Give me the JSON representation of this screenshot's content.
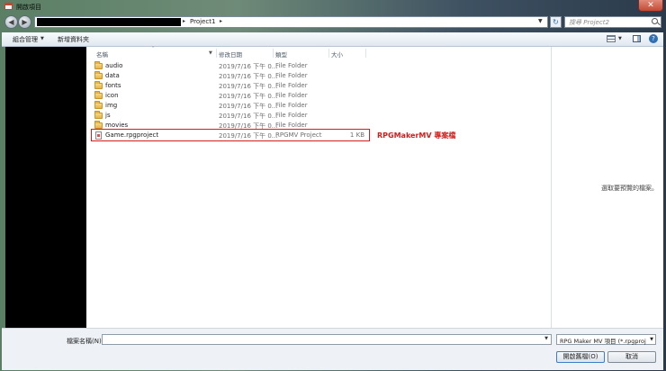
{
  "window": {
    "title": "開啟項目"
  },
  "address": {
    "crumb": "Project1",
    "sep": "▸"
  },
  "search": {
    "placeholder": "搜尋 Project2"
  },
  "toolbar": {
    "organize_label": "組合管理",
    "new_folder_label": "新增資料夾"
  },
  "columns": {
    "name": "名稱",
    "date": "修改日期",
    "type": "類型",
    "size": "大小"
  },
  "files": [
    {
      "name": "audio",
      "date": "2019/7/16 下午 0...",
      "type": "File Folder",
      "size": "",
      "kind": "folder"
    },
    {
      "name": "data",
      "date": "2019/7/16 下午 0...",
      "type": "File Folder",
      "size": "",
      "kind": "folder"
    },
    {
      "name": "fonts",
      "date": "2019/7/16 下午 0...",
      "type": "File Folder",
      "size": "",
      "kind": "folder"
    },
    {
      "name": "icon",
      "date": "2019/7/16 下午 0...",
      "type": "File Folder",
      "size": "",
      "kind": "folder"
    },
    {
      "name": "img",
      "date": "2019/7/16 下午 0...",
      "type": "File Folder",
      "size": "",
      "kind": "folder"
    },
    {
      "name": "js",
      "date": "2019/7/16 下午 0...",
      "type": "File Folder",
      "size": "",
      "kind": "folder"
    },
    {
      "name": "movies",
      "date": "2019/7/16 下午 0...",
      "type": "File Folder",
      "size": "",
      "kind": "folder"
    },
    {
      "name": "Game.rpgproject",
      "date": "2019/7/16 下午 0...",
      "type": "RPGMV Project",
      "size": "1 KB",
      "kind": "file"
    }
  ],
  "annotation": "RPGMakerMV 專案檔",
  "preview": {
    "message": "選取要預覽的檔案。"
  },
  "bottom": {
    "filename_label": "檔案名稱(N):",
    "filename_value": "",
    "filter_value": "RPG Maker MV 項目 (*.rpgproject)",
    "open_label": "開啟舊檔(O)",
    "cancel_label": "取消"
  },
  "colors": {
    "accent": "#d21d1d",
    "nav_bg": "#000000"
  }
}
